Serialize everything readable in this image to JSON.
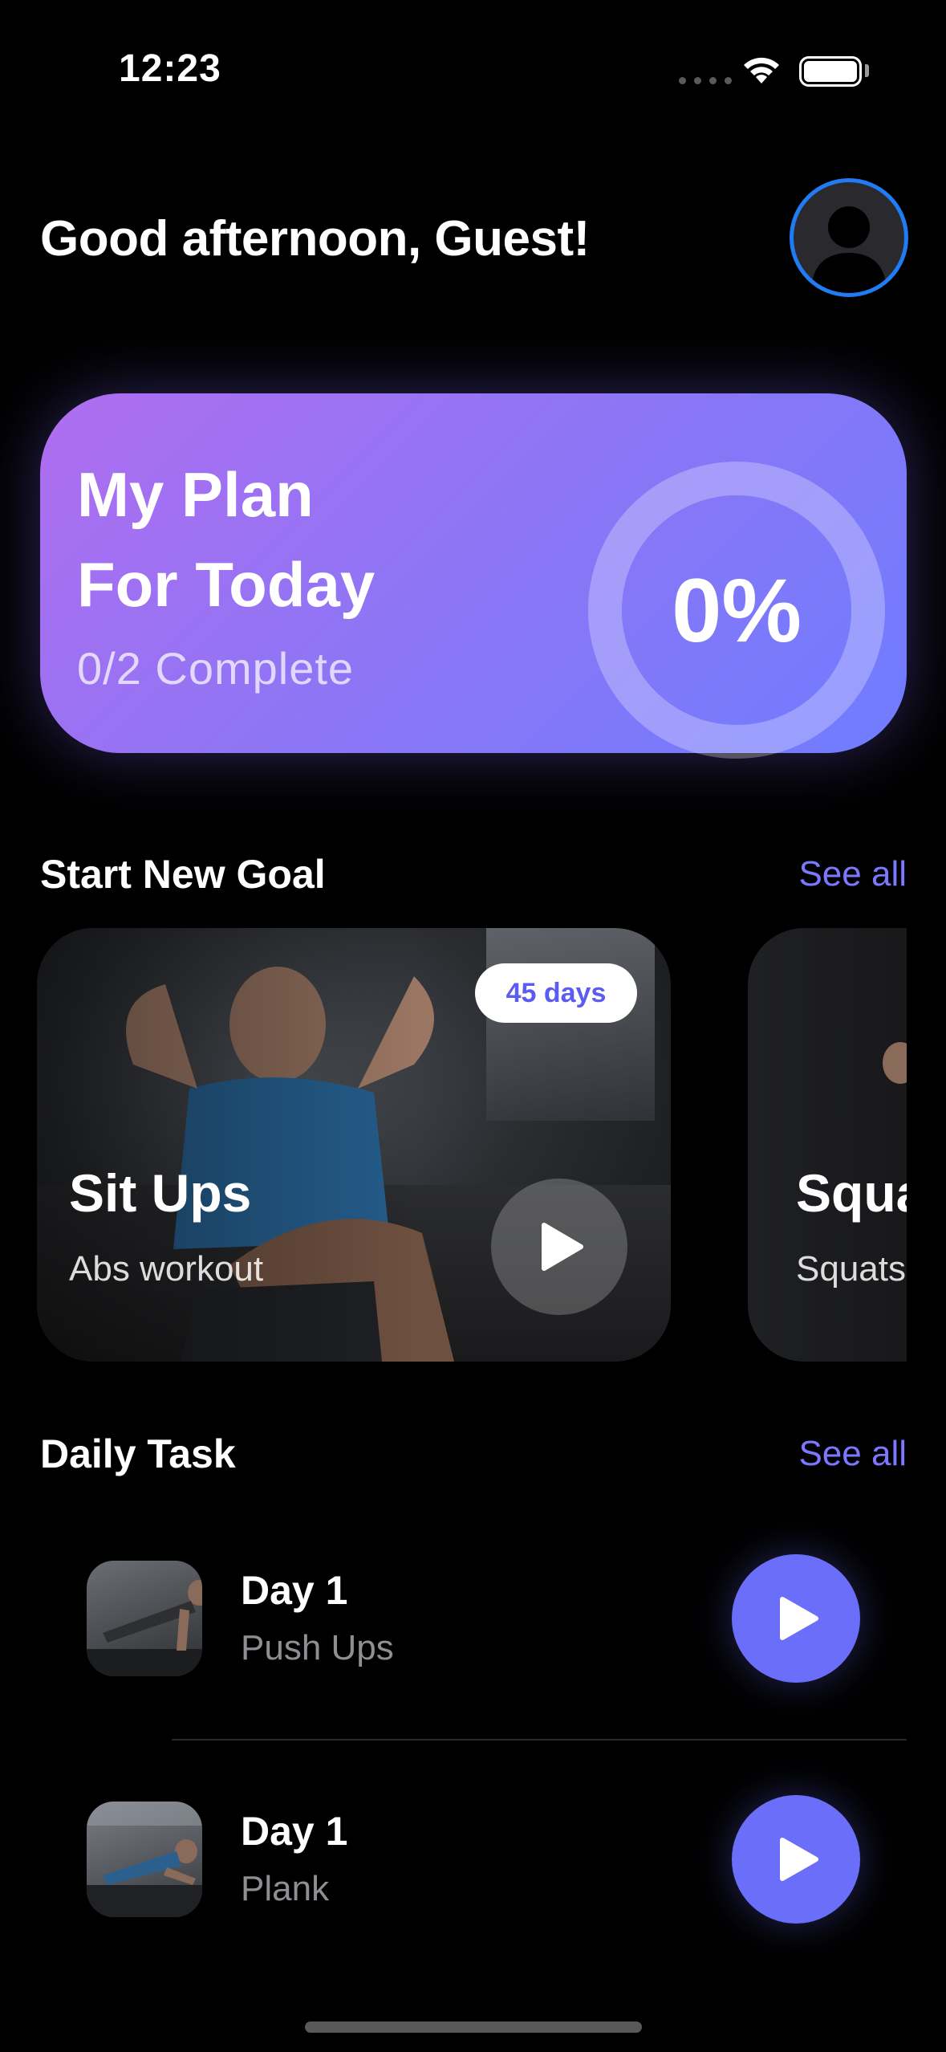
{
  "status_bar": {
    "time": "12:23"
  },
  "header": {
    "greeting": "Good afternoon, Guest!"
  },
  "plan": {
    "title_line1": "My Plan",
    "title_line2": "For Today",
    "subtitle": "0/2 Complete",
    "progress_label": "0%",
    "progress": 0
  },
  "goals_section": {
    "title": "Start New Goal",
    "see_all": "See all",
    "cards": [
      {
        "title": "Sit Ups",
        "subtitle": "Abs workout",
        "badge": "45 days"
      },
      {
        "title": "Squa",
        "subtitle": "Squats"
      }
    ]
  },
  "tasks_section": {
    "title": "Daily Task",
    "see_all": "See all",
    "items": [
      {
        "day": "Day 1",
        "name": "Push Ups"
      },
      {
        "day": "Day 1",
        "name": "Plank"
      }
    ]
  },
  "colors": {
    "accent": "#6b6ef8",
    "link": "#7b78ff",
    "avatar_ring": "#1f7cf2",
    "card_gradient_start": "#b06df0",
    "card_gradient_end": "#6f7cff"
  },
  "icons": [
    "wifi-icon",
    "battery-icon",
    "user-icon",
    "play-icon"
  ]
}
